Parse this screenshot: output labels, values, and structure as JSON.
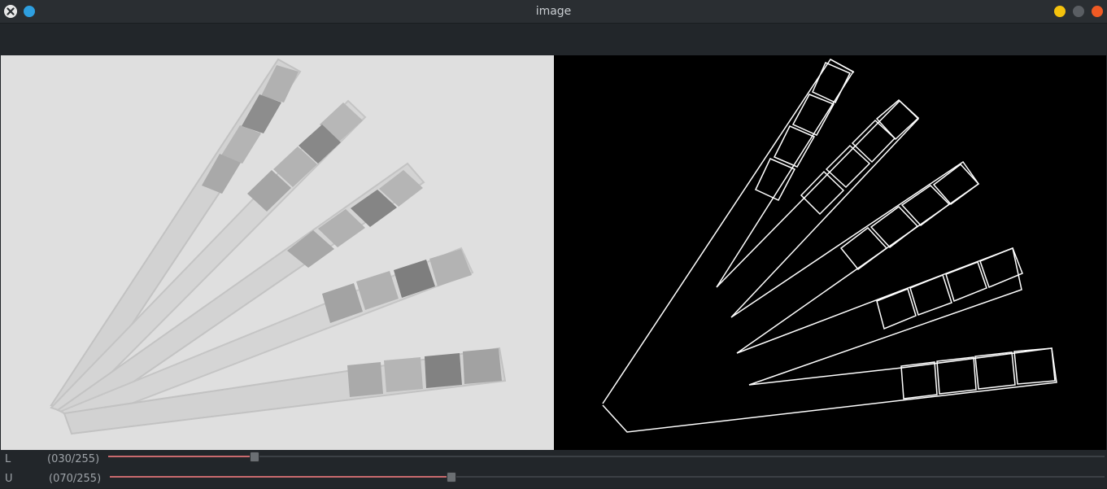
{
  "window": {
    "title": "image",
    "controls": [
      "close-icon",
      "pin-icon",
      "minimize-icon",
      "maximize-icon",
      "close-window-icon"
    ]
  },
  "trackbars": [
    {
      "name": "L",
      "value_text": "(030/255)",
      "value": 30,
      "max": 255
    },
    {
      "name": "U",
      "value_text": "(070/255)",
      "value": 70,
      "max": 255
    }
  ],
  "colors": {
    "accent": "#c96a6e",
    "background": "#1f2326",
    "pin": "#2e9fe0",
    "minimize": "#f4c20d",
    "close": "#f05a24"
  }
}
